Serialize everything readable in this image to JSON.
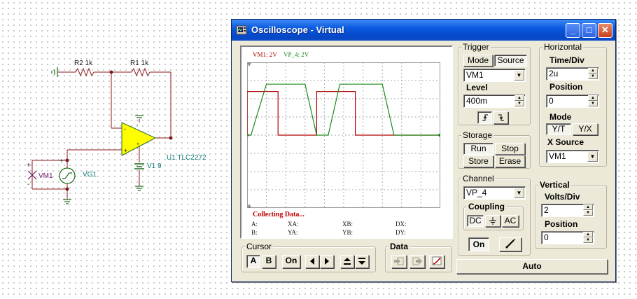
{
  "schematic": {
    "r2": "R2 1k",
    "r1": "R1 1k",
    "u1": "U1 TLC2272",
    "v1": "V1 9",
    "vm1": "VM1",
    "vg1": "VG1",
    "plus": "+",
    "minus": "-"
  },
  "window": {
    "title": "Oscilloscope - Virtual",
    "minimize": "_",
    "maximize": "□",
    "close": "✕"
  },
  "screen": {
    "legend_ch1": "VM1: 2V",
    "legend_ch2": "VP_4: 2V",
    "status": "Collecting Data...",
    "readouts": {
      "a": "A:",
      "xa": "XA:",
      "xb": "XB:",
      "dx": "DX:",
      "b": "B:",
      "ya": "YA:",
      "yb": "YB:",
      "dy": "DY:"
    },
    "colors": {
      "ch1": "#b00000",
      "ch2": "#1a8a1a",
      "grid": "#a8a8a8"
    }
  },
  "chart_data": {
    "type": "line",
    "grid": true,
    "series": [
      {
        "name": "VM1: 2V",
        "color": "#b00000",
        "x": [
          0,
          0.0,
          1.6,
          1.6,
          3.6,
          3.6,
          5.6,
          5.6,
          7.6,
          7.6,
          10.2
        ],
        "y": [
          0,
          2.4,
          2.4,
          0,
          0,
          2.4,
          2.4,
          0,
          0,
          0,
          0
        ]
      },
      {
        "name": "VP_4: 2V",
        "color": "#1a8a1a",
        "x": [
          0,
          0.2,
          1.0,
          3.0,
          3.6,
          4.2,
          4.8,
          5.4,
          6.0,
          6.4,
          7.0,
          7.6,
          8.2,
          9.0,
          10.2
        ],
        "y": [
          0,
          0,
          2.8,
          2.8,
          0,
          0,
          2.8,
          2.8,
          2.8,
          2.8,
          2.8,
          0,
          0,
          0,
          0
        ]
      }
    ]
  },
  "trigger": {
    "title": "Trigger",
    "mode": "Mode",
    "source": "Source",
    "source_value": "VM1",
    "level_label": "Level",
    "level_value": "400m",
    "rising_icon": "rising-edge-icon",
    "falling_icon": "falling-edge-icon"
  },
  "horizontal": {
    "title": "Horizontal",
    "time_div_label": "Time/Div",
    "time_div_value": "2u",
    "position_label": "Position",
    "position_value": "0",
    "mode_label": "Mode",
    "yt": "Y/T",
    "yx": "Y/X",
    "xsource_label": "X Source",
    "xsource_value": "VM1"
  },
  "storage": {
    "title": "Storage",
    "run": "Run",
    "stop": "Stop",
    "store": "Store",
    "erase": "Erase"
  },
  "channel": {
    "title": "Channel",
    "value": "VP_4",
    "coupling_title": "Coupling",
    "dc": "DC",
    "gnd_icon": "ground-icon",
    "ac": "AC",
    "on": "On",
    "probe_icon": "probe-icon"
  },
  "vertical": {
    "title": "Vertical",
    "volts_div_label": "Volts/Div",
    "volts_div_value": "2",
    "position_label": "Position",
    "position_value": "0"
  },
  "cursor": {
    "title": "Cursor",
    "a": "A",
    "b": "B",
    "on": "On",
    "left_icon": "arrow-left-icon",
    "right_icon": "arrow-right-icon",
    "up_icon": "arrow-up-icon",
    "down_icon": "arrow-down-icon"
  },
  "data": {
    "title": "Data",
    "import_icon": "import-icon",
    "export_icon": "export-icon",
    "curve_icon": "curve-icon"
  },
  "auto": "Auto"
}
